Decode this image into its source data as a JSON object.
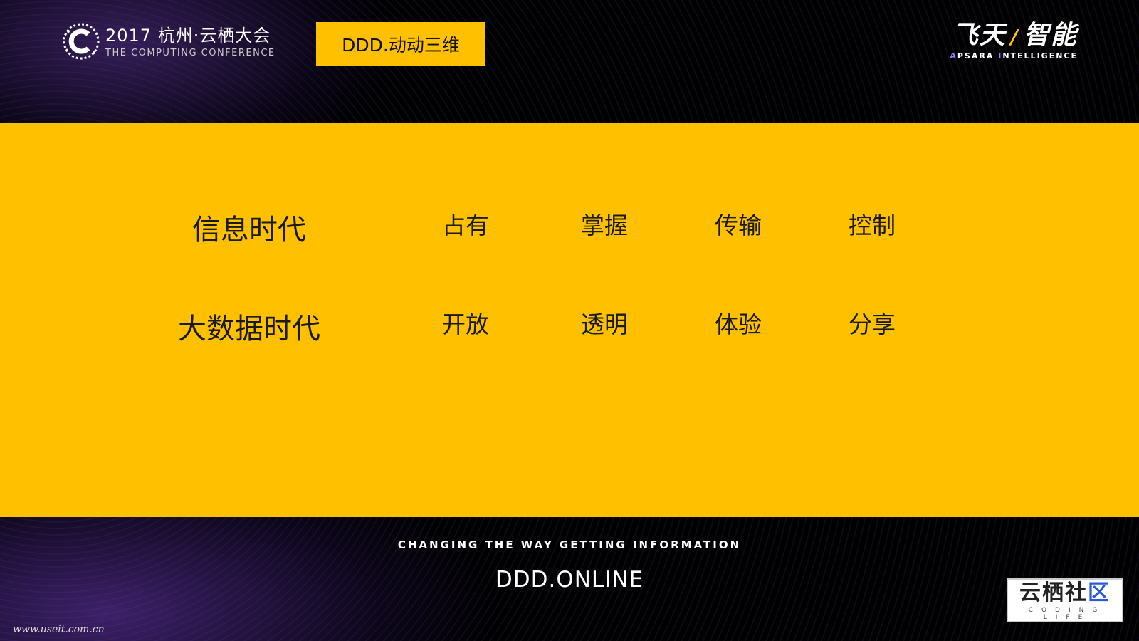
{
  "header": {
    "conf_title": "2017 杭州·云栖大会",
    "conf_subtitle": "THE COMPUTING CONFERENCE",
    "tag": "DDD.动动三维",
    "brand_cn_1": "飞天",
    "brand_cn_2": "智能",
    "brand_en_a1": "A",
    "brand_en_1": "PSARA ",
    "brand_en_a2": "I",
    "brand_en_2": "NTELLIGENCE"
  },
  "content": {
    "rows": [
      {
        "era": "信息时代",
        "words": [
          "占有",
          "掌握",
          "传输",
          "控制"
        ]
      },
      {
        "era": "大数据时代",
        "words": [
          "开放",
          "透明",
          "体验",
          "分享"
        ]
      }
    ]
  },
  "footer": {
    "slogan": "CHANGING THE WAY GETTING INFORMATION",
    "site": "DDD.ONLINE",
    "watermark": "www.useit.com.cn",
    "community_cn_1": "云栖社",
    "community_cn_2": "区",
    "community_en": "CODING LIFE"
  },
  "colors": {
    "accent": "#ffc000",
    "background": "#000000",
    "text_dark": "#1a1a1a"
  }
}
